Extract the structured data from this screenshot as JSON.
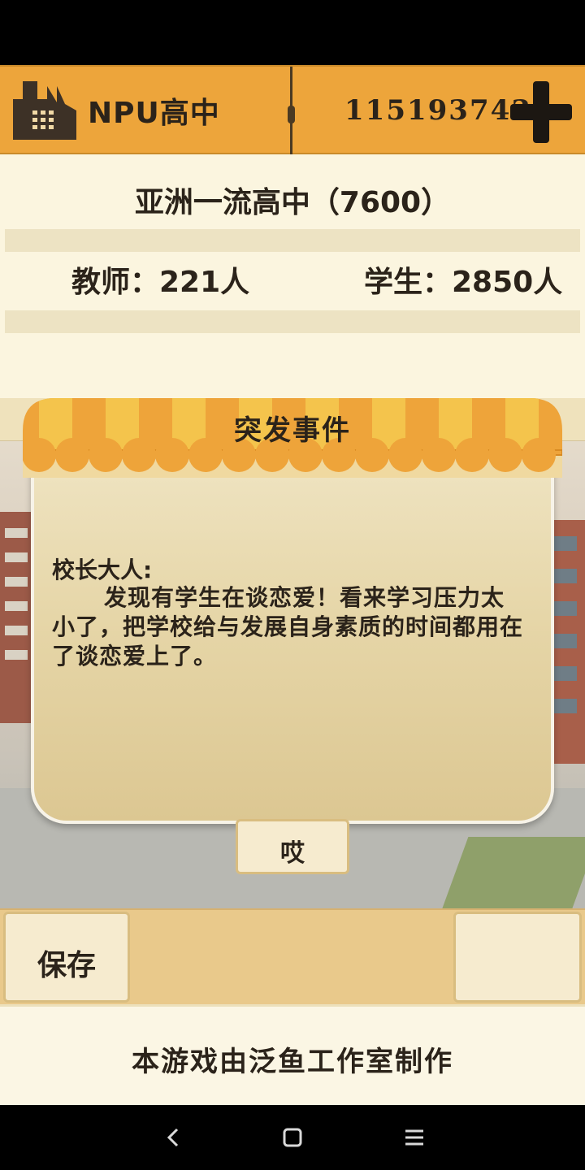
{
  "header": {
    "school_name": "NPU高中",
    "money": "115193743",
    "icons": {
      "school": "factory-icon",
      "add": "plus-icon"
    }
  },
  "info": {
    "rank_text": "亚洲一流高中（7600）",
    "teachers": "教师：221人",
    "students": "学生：2850人"
  },
  "modal": {
    "title": "突发事件",
    "salutation": "校长大人:",
    "message": "发现有学生在谈恋爱！看来学习压力太小了，把学校给与发展自身素质的时间都用在了谈恋爱上了。",
    "confirm_label": "哎"
  },
  "bottom_bar": {
    "save_label": "保存",
    "right_button_label": ""
  },
  "footer": {
    "credit": "本游戏由泛鱼工作室制作"
  },
  "nav": {
    "icons": [
      "back-icon",
      "home-icon",
      "menu-icon"
    ]
  },
  "colors": {
    "header_orange": "#eda53b",
    "panel_cream": "#fbf5df",
    "text_dark": "#2b231a",
    "awning_yellow": "#f3be48"
  }
}
